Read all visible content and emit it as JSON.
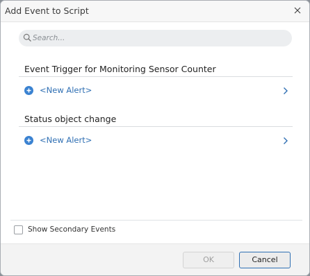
{
  "window": {
    "title": "Add Event to Script",
    "close_icon": "close-icon"
  },
  "search": {
    "placeholder": "Search...",
    "value": ""
  },
  "sections": [
    {
      "title": "Event Trigger for Monitoring Sensor Counter",
      "item_label": "<New Alert>"
    },
    {
      "title": "Status object change",
      "item_label": "<New Alert>"
    }
  ],
  "options": {
    "show_secondary_label": "Show Secondary Events",
    "show_secondary_checked": false
  },
  "buttons": {
    "ok": "OK",
    "cancel": "Cancel"
  },
  "colors": {
    "accent": "#2f6fb3",
    "plus_icon": "#3a82d1"
  }
}
